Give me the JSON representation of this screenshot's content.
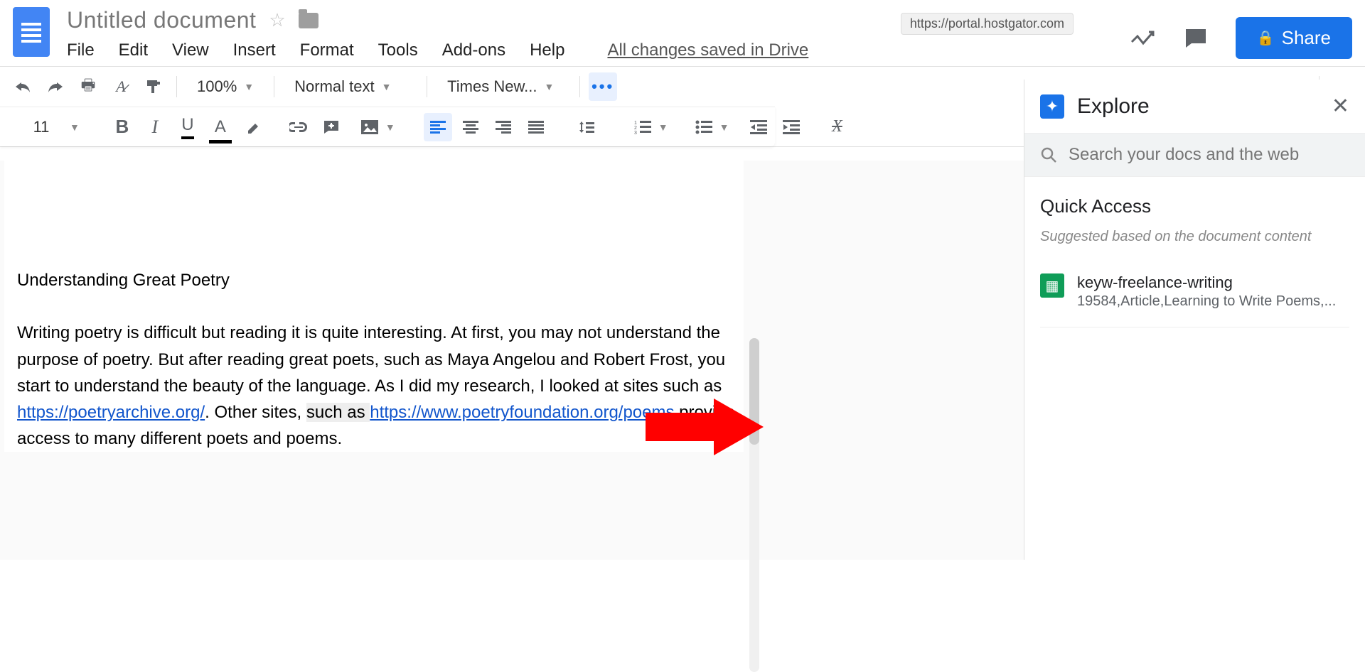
{
  "header": {
    "title": "Untitled document",
    "menus": {
      "file": "File",
      "edit": "Edit",
      "view": "View",
      "insert": "Insert",
      "format": "Format",
      "tools": "Tools",
      "addons": "Add-ons",
      "help": "Help"
    },
    "save_status": "All changes saved in Drive",
    "share_label": "Share",
    "url_tooltip": "https://portal.hostgator.com"
  },
  "toolbar": {
    "zoom": "100%",
    "style": "Normal text",
    "font": "Times New...",
    "fontsize": "11"
  },
  "document": {
    "heading": "Understanding Great Poetry",
    "p1a": "Writing poetry is difficult but reading it is quite interesting. At first, you may not understand the purpose of poetry. But after reading great poets, such as Maya Angelou and Robert Frost, you start to understand the beauty of the language. As I did my research, I looked at sites such as ",
    "link1": "https://poetryarchive.org/",
    "p1b": ". Other sites, ",
    "p1c": "such as ",
    "link2": "https://www.poetryfoundation.org/poems",
    "p1d": " provide access to many different poets and poems."
  },
  "explore": {
    "title": "Explore",
    "search_placeholder": "Search your docs and the web",
    "quick_access": "Quick Access",
    "suggested": "Suggested based on the document content",
    "item_title": "keyw-freelance-writing",
    "item_meta": "19584,Article,Learning to Write Poems,..."
  }
}
